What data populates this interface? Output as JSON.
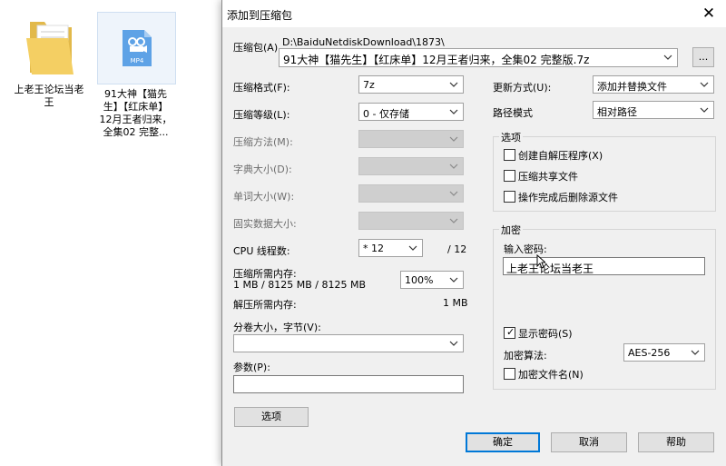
{
  "desktop": {
    "folder": {
      "label": "上老王论坛当老王"
    },
    "video": {
      "badge": "MP4",
      "label": "91大神【猫先生】【红床单】12月王者归来，全集02 完整..."
    }
  },
  "dialog": {
    "title": "添加到压缩包",
    "close_glyph": "✕",
    "archive": {
      "label": "压缩包(A)",
      "path": "D:\\BaiduNetdiskDownload\\1873\\",
      "name": "91大神【猫先生】【红床单】12月王者归来，全集02 完整版.7z",
      "browse_label": "..."
    },
    "left": {
      "format_label": "压缩格式(F):",
      "format_value": "7z",
      "level_label": "压缩等级(L):",
      "level_value": "0 - 仅存储",
      "method_label": "压缩方法(M):",
      "dict_label": "字典大小(D):",
      "word_label": "单词大小(W):",
      "solid_label": "固实数据大小:",
      "cpu_label": "CPU 线程数:",
      "cpu_value": "* 12",
      "cpu_total": "/ 12",
      "mem_label": "压缩所需内存:",
      "mem_value": "1 MB / 8125 MB / 8125 MB",
      "mem_percent": "100%",
      "decomp_label": "解压所需内存:",
      "decomp_value": "1 MB",
      "split_label": "分卷大小，字节(V):",
      "split_value": "",
      "params_label": "参数(P):",
      "params_value": "",
      "options_button": "选项"
    },
    "right": {
      "update_label": "更新方式(U):",
      "update_value": "添加并替换文件",
      "path_label": "路径模式",
      "path_value": "相对路径",
      "options_group": "选项",
      "opt_sfx": "创建自解压程序(X)",
      "opt_shared": "压缩共享文件",
      "opt_delete": "操作完成后删除源文件",
      "encrypt_group": "加密",
      "password_label": "输入密码:",
      "password_value": "上老王论坛当老王",
      "show_password": "显示密码(S)",
      "method_label": "加密算法:",
      "method_value": "AES-256",
      "encrypt_names": "加密文件名(N)"
    },
    "buttons": {
      "ok": "确定",
      "cancel": "取消",
      "help": "帮助"
    }
  }
}
